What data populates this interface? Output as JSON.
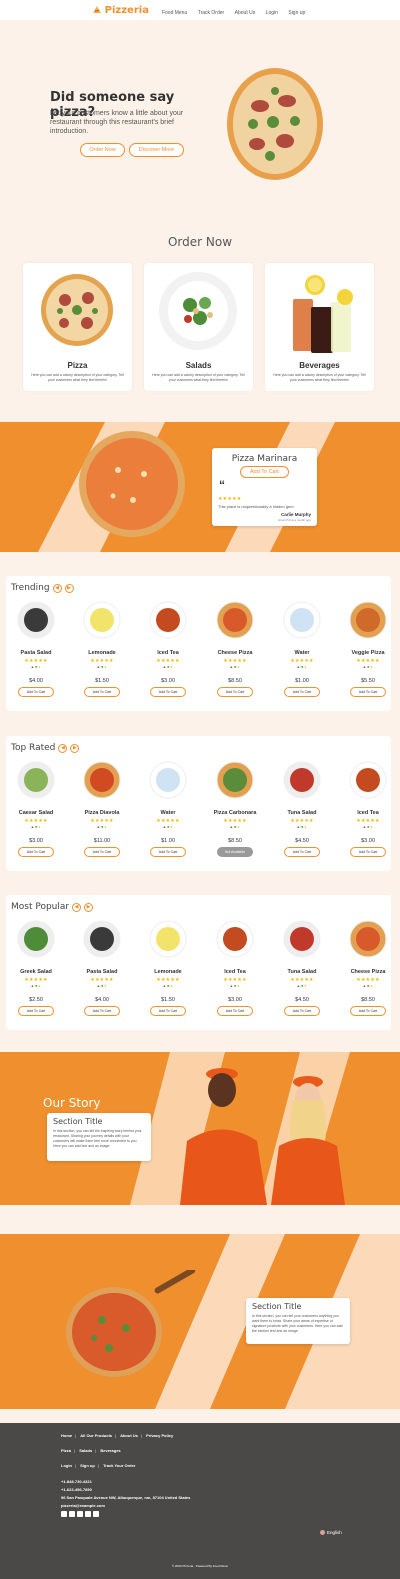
{
  "header": {
    "brand": "Pizzeria",
    "nav": [
      "Food Menu",
      "Track Order",
      "About Us",
      "Login",
      "Sign up"
    ]
  },
  "hero": {
    "title": "Did someone say pizza?",
    "subtitle": "Let your customers know a little about your restaurant through this restaurant's brief introduction.",
    "btn_order": "Order Now",
    "btn_discover": "Discover More"
  },
  "order_now": {
    "title": "Order Now",
    "cards": [
      {
        "title": "Pizza",
        "desc": "Here you can add a catchy description of your category. Tell your customers what they find therein!"
      },
      {
        "title": "Salads",
        "desc": "Here you can add a catchy description of your category. Tell your customers what they find therein!"
      },
      {
        "title": "Beverages",
        "desc": "Here you can add a catchy description of your category. Tell your customers what they find therein!"
      }
    ]
  },
  "featured": {
    "name": "Pizza Marinara",
    "add": "Add To Cart",
    "quote_mark": "“",
    "stars": "★★★★★",
    "review": "This place is unquestionably a hidden gem.",
    "reviewer": "Carlie Murphy",
    "reviewer_sub": "Hired Pizza a month ago"
  },
  "trending": {
    "title": "Trending",
    "items": [
      {
        "name": "Pasta Salad",
        "price": "$4.00",
        "btn": "Add To Cart"
      },
      {
        "name": "Lemonade",
        "price": "$1.50",
        "btn": "Add To Cart"
      },
      {
        "name": "Iced Tea",
        "price": "$3.00",
        "btn": "Add To Cart"
      },
      {
        "name": "Cheese Pizza",
        "price": "$8.50",
        "btn": "Add To Cart"
      },
      {
        "name": "Water",
        "price": "$1.00",
        "btn": "Add To Cart"
      },
      {
        "name": "Veggie Pizza",
        "price": "$5.50",
        "btn": "Add To Cart"
      }
    ]
  },
  "top_rated": {
    "title": "Top Rated",
    "items": [
      {
        "name": "Caesar Salad",
        "price": "$3.00",
        "btn": "Add To Cart"
      },
      {
        "name": "Pizza Diavola",
        "price": "$11.00",
        "btn": "Add To Cart"
      },
      {
        "name": "Water",
        "price": "$1.00",
        "btn": "Add To Cart"
      },
      {
        "name": "Pizza Carbonara",
        "price": "$8.50",
        "btn": "Not Available"
      },
      {
        "name": "Tuna Salad",
        "price": "$4.50",
        "btn": "Add To Cart"
      },
      {
        "name": "Iced Tea",
        "price": "$3.00",
        "btn": "Add To Cart"
      }
    ]
  },
  "most_popular": {
    "title": "Most Popular",
    "items": [
      {
        "name": "Greek Salad",
        "price": "$2.50",
        "btn": "Add To Cart"
      },
      {
        "name": "Pasta Salad",
        "price": "$4.00",
        "btn": "Add To Cart"
      },
      {
        "name": "Lemonade",
        "price": "$1.50",
        "btn": "Add To Cart"
      },
      {
        "name": "Iced Tea",
        "price": "$3.00",
        "btn": "Add To Cart"
      },
      {
        "name": "Tuna Salad",
        "price": "$4.50",
        "btn": "Add To Cart"
      },
      {
        "name": "Cheese Pizza",
        "price": "$8.50",
        "btn": "Add To Cart"
      }
    ]
  },
  "stars": "★★★★★",
  "our_story": {
    "heading": "Our Story",
    "section_title": "Section Title",
    "text": "In this section, you can tell the inspiring story behind your restaurant. Sharing your journey details with your customers will make them feel more connected to you. Here you can add text and an image."
  },
  "section2": {
    "section_title": "Section Title",
    "text": "In this section, you can tell your customers anything you want them to know. Share your areas of expertise or signature products with your customers. Here you can add the section text and an image."
  },
  "footer": {
    "links1": [
      "Home",
      "All Our Products",
      "About Us",
      "Privacy Policy"
    ],
    "links2": [
      "Pizza",
      "Salads",
      "Beverages"
    ],
    "links3": [
      "Login",
      "Sign up",
      "Track Your Order"
    ],
    "phone1": "+1-848-730-4321",
    "phone2": "+1-623-456-7890",
    "address": "96 San Pasquale Avenue NW, Albuquerque, nm, 87104 United States",
    "email": "pizzeria@example.com",
    "language": "English",
    "copyright": "© 2023 Pizzeria · Powered By Food Menu"
  },
  "colors": {
    "accent": "#ef8f2e",
    "band": "#fbd9b9",
    "footer": "#4a4948"
  }
}
